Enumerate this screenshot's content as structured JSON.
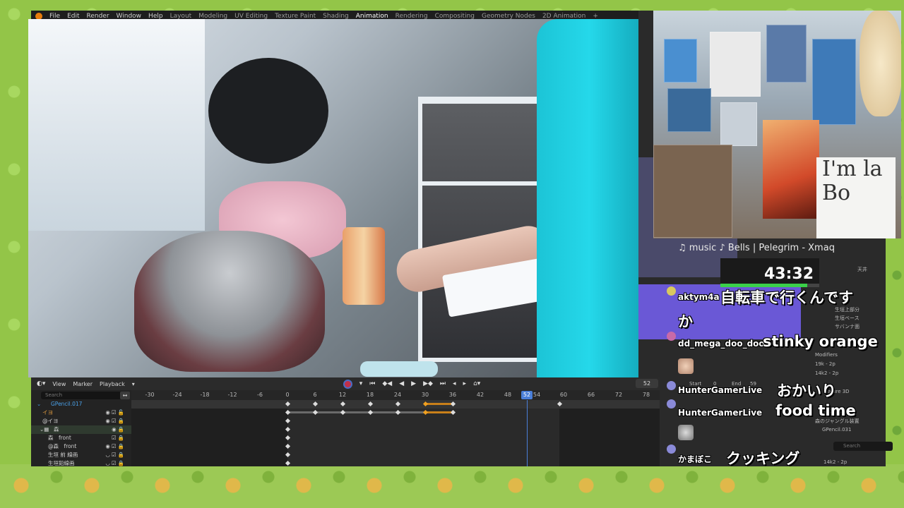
{
  "menubar": {
    "items": [
      "File",
      "Edit",
      "Render",
      "Window",
      "Help"
    ],
    "workspaces": [
      "Layout",
      "Modeling",
      "UV Editing",
      "Texture Paint",
      "Shading",
      "Animation",
      "Rendering",
      "Compositing",
      "Geometry Nodes",
      "2D Animation",
      "+"
    ],
    "active_workspace": "Animation"
  },
  "timeline": {
    "header": {
      "view": "View",
      "marker": "Marker",
      "playback": "Playback",
      "current_frame": "52"
    },
    "search_placeholder": "Search",
    "ruler": [
      "-30",
      "-24",
      "-18",
      "-12",
      "-6",
      "0",
      "6",
      "12",
      "18",
      "24",
      "30",
      "36",
      "42",
      "48",
      "52",
      "54",
      "60",
      "66",
      "72",
      "78"
    ],
    "current_frame": "52",
    "tree": [
      {
        "label": "GPencil.017",
        "color": "#4aa0e8"
      },
      {
        "label": "イヨ",
        "color": "#e8a040"
      },
      {
        "label": "@イヨ",
        "color": "#cfcfcf"
      },
      {
        "label": "森",
        "color": "#cfcfcf"
      },
      {
        "label": "森　front",
        "color": "#cfcfcf"
      },
      {
        "label": "@森　front",
        "color": "#cfcfcf"
      },
      {
        "label": "生垣 前 線画",
        "color": "#cfcfcf"
      },
      {
        "label": "生垣鉛線画",
        "color": "#cfcfcf"
      }
    ]
  },
  "right_panel": {
    "outliner": [
      "天井",
      "生垣上部分",
      "生垣ベース",
      "サバンナ面",
      "Modifiers",
      "19k - 2p",
      "14k2 - 2p",
      "ature 3D",
      "Camera",
      "森のジャングル装置",
      "GPencil.031"
    ],
    "search_placeholder": "Search",
    "bottom_label": "14k2 - 2p",
    "sidebar_labels": [
      "Start",
      "0",
      "End",
      "59"
    ]
  },
  "music": "♫ music ♪ Bells | Pelegrim - Xmaq",
  "timer": "43:32",
  "timer_progress": 0.88,
  "chat": [
    {
      "user": "aktym4a",
      "text": "自転車で行くんです",
      "text2": "か"
    },
    {
      "user": "dd_mega_doo_doo",
      "text": "stinky orange"
    },
    {
      "user": "HunterGamerLive",
      "text": "おかいり"
    },
    {
      "user": "HunterGamerLive",
      "text": "food time"
    },
    {
      "user": "かまぼこ",
      "text": "クッキング"
    }
  ],
  "cam2_sign": "I'm la Bo"
}
